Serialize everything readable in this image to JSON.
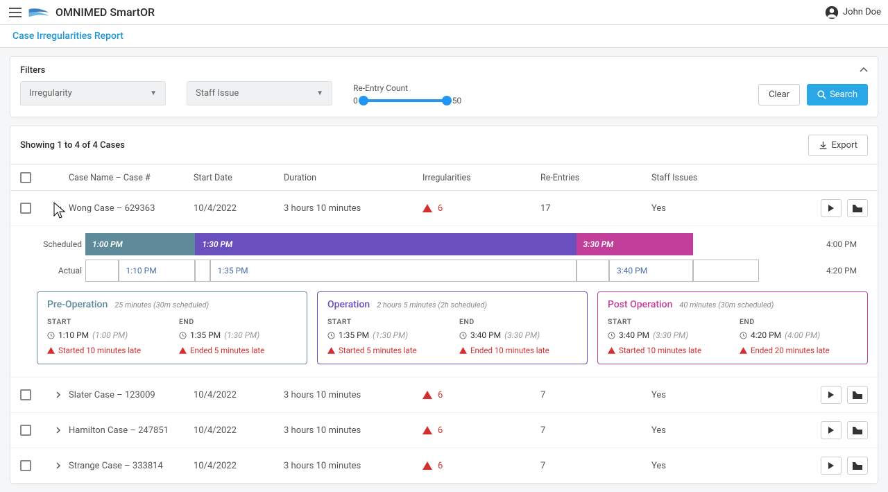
{
  "app": {
    "name": "OMNIMED SmartOR",
    "user": "John Doe"
  },
  "page": {
    "title": "Case Irregularities Report"
  },
  "filters": {
    "title": "Filters",
    "select1": "Irregularity",
    "select2": "Staff Issue",
    "slider_label": "Re-Entry Count",
    "slider_min": "0",
    "slider_max": "50",
    "clear": "Clear",
    "search": "Search"
  },
  "results": {
    "count_text": "Showing 1 to 4 of 4 Cases",
    "export": "Export"
  },
  "columns": {
    "case": "Case Name – Case #",
    "start": "Start Date",
    "duration": "Duration",
    "irreg": "Irregularities",
    "reentry": "Re-Entries",
    "staff": "Staff Issues"
  },
  "rows": [
    {
      "expanded": true,
      "case": "Wong Case – 629363",
      "start": "10/4/2022",
      "duration": "3 hours 10 minutes",
      "irreg": "6",
      "reentry": "17",
      "staff": "Yes"
    },
    {
      "expanded": false,
      "case": "Slater Case – 123009",
      "start": "10/4/2022",
      "duration": "3 hours 10 minutes",
      "irreg": "6",
      "reentry": "7",
      "staff": "Yes"
    },
    {
      "expanded": false,
      "case": "Hamilton Case – 247851",
      "start": "10/4/2022",
      "duration": "3 hours 10 minutes",
      "irreg": "6",
      "reentry": "7",
      "staff": "Yes"
    },
    {
      "expanded": false,
      "case": "Strange Case – 333814",
      "start": "10/4/2022",
      "duration": "3 hours 10 minutes",
      "irreg": "6",
      "reentry": "7",
      "staff": "Yes"
    }
  ],
  "timeline": {
    "sched_label": "Scheduled",
    "actual_label": "Actual",
    "sched": {
      "preop": "1:00 PM",
      "op": "1:30 PM",
      "post": "3:30 PM",
      "end": "4:00 PM"
    },
    "actual": {
      "preop": "1:10 PM",
      "op": "1:35 PM",
      "post": "3:40 PM",
      "end": "4:20 PM"
    }
  },
  "phases": {
    "preop": {
      "title": "Pre-Operation",
      "sub": "25 minutes  (30m scheduled)",
      "start_label": "START",
      "end_label": "END",
      "start_t": "1:10 PM",
      "start_s": "(1:00 PM)",
      "end_t": "1:35 PM",
      "end_s": "(1:30 PM)",
      "warn_start": "Started 10 minutes late",
      "warn_end": "Ended 5 minutes late"
    },
    "op": {
      "title": "Operation",
      "sub": "2 hours 5 minutes  (2h scheduled)",
      "start_label": "START",
      "end_label": "END",
      "start_t": "1:35 PM",
      "start_s": "(1:30 PM)",
      "end_t": "3:40 PM",
      "end_s": "(3:30 PM)",
      "warn_start": "Started 5 minutes late",
      "warn_end": "Ended 10 minutes late"
    },
    "post": {
      "title": "Post Operation",
      "sub": "40 minutes  (30m scheduled)",
      "start_label": "START",
      "end_label": "END",
      "start_t": "3:40 PM",
      "start_s": "(3:30 PM)",
      "end_t": "4:20 PM",
      "end_s": "(4:00 PM)",
      "warn_start": "Started 10 minutes late",
      "warn_end": "Ended 20 minutes late"
    }
  }
}
